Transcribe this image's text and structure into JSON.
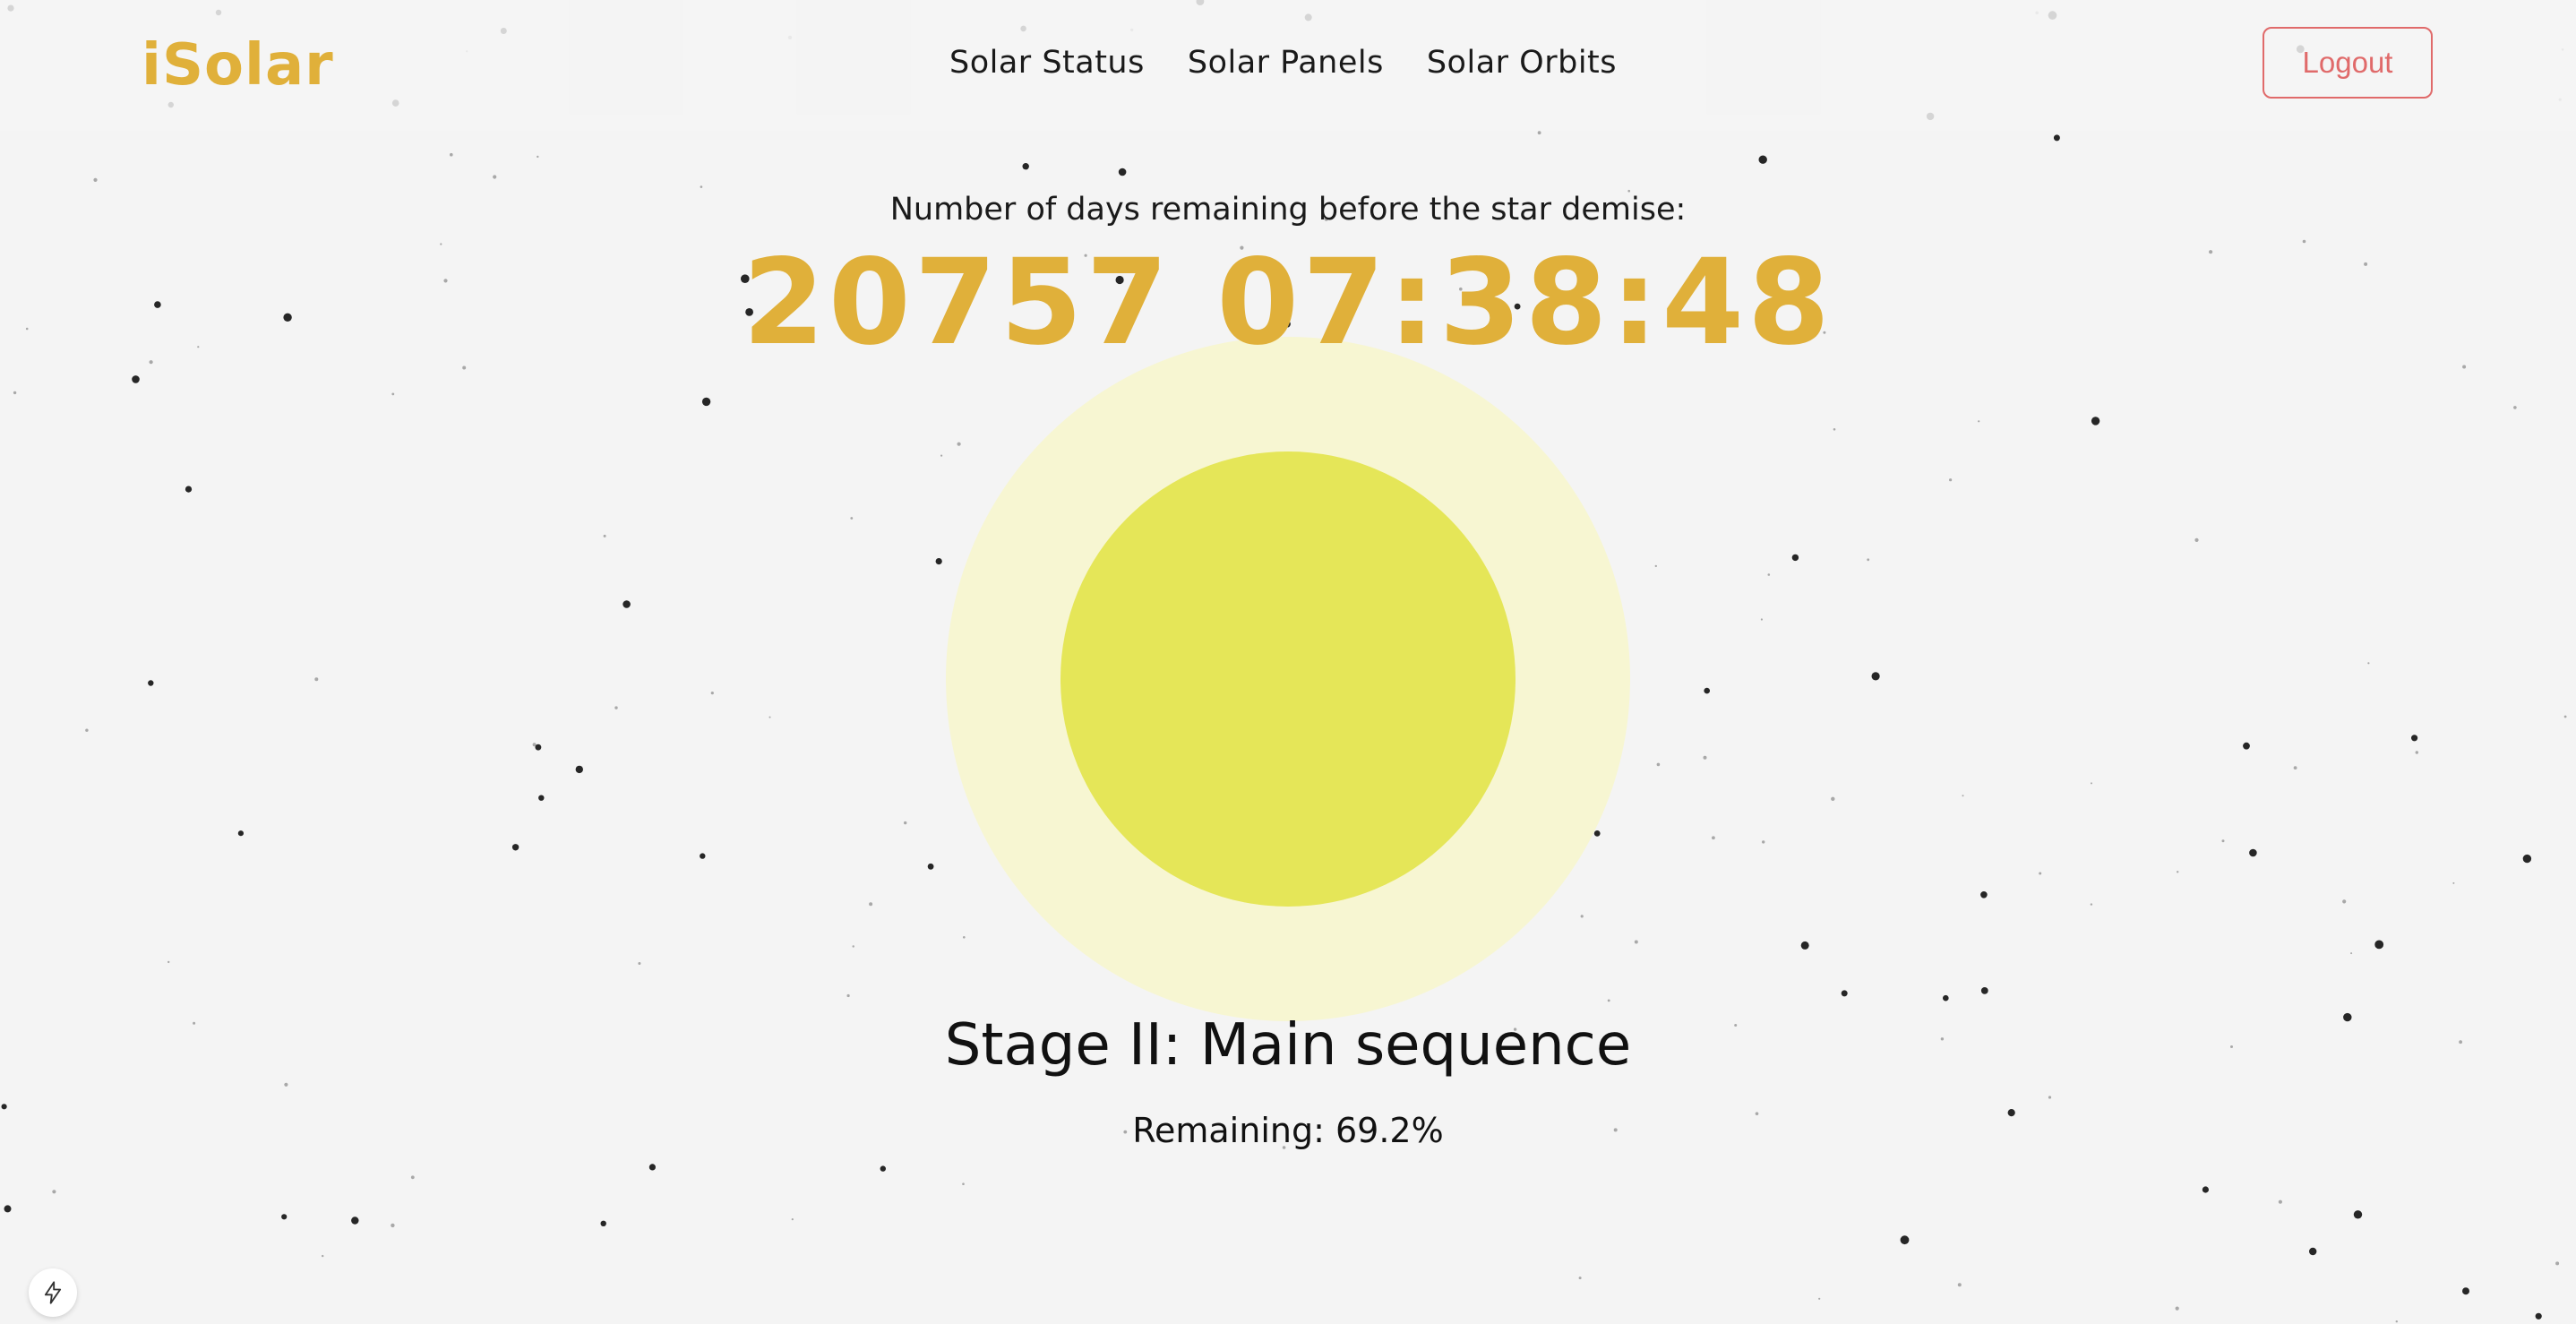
{
  "header": {
    "logo": "iSolar",
    "nav": [
      {
        "label": "Solar Status"
      },
      {
        "label": "Solar Panels"
      },
      {
        "label": "Solar Orbits"
      }
    ],
    "logout_label": "Logout"
  },
  "main": {
    "countdown_label": "Number of days remaining before the star demise:",
    "countdown_value": "20757 07:38:48",
    "stage_title": "Stage II: Main sequence",
    "remaining_text": "Remaining: 69.2%",
    "remaining_fraction": 0.692
  },
  "colors": {
    "accent": "#e0b03a",
    "logout": "#e06a6a",
    "sun_core": "#e5e658",
    "sun_glow": "#f7f6d2",
    "background": "#f4f4f4",
    "star": "#1a1a1a"
  },
  "icons": {
    "dev_badge": "lightning-icon"
  }
}
